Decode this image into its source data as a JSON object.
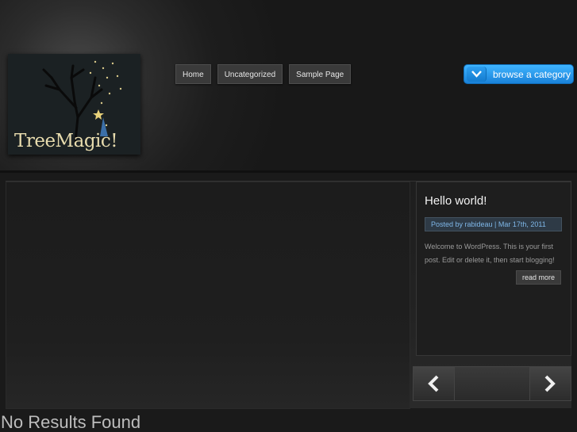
{
  "site": {
    "logo_text": "TreeMagic!"
  },
  "nav": {
    "items": [
      {
        "label": "Home"
      },
      {
        "label": "Uncategorized"
      },
      {
        "label": "Sample Page"
      }
    ]
  },
  "browse": {
    "label": "browse a category",
    "icon": "chevron-down-icon",
    "accent": "#2a9ff0"
  },
  "featured_post": {
    "title": "Hello world!",
    "meta": "Posted by rabideau | Mar 17th, 2011",
    "excerpt": "Welcome to WordPress. This is your first post. Edit or delete it, then start blogging!",
    "read_more": "read more"
  },
  "slider_controls": {
    "prev_icon": "chevron-left-icon",
    "next_icon": "chevron-right-icon"
  },
  "main": {
    "heading": "No Results Found"
  }
}
